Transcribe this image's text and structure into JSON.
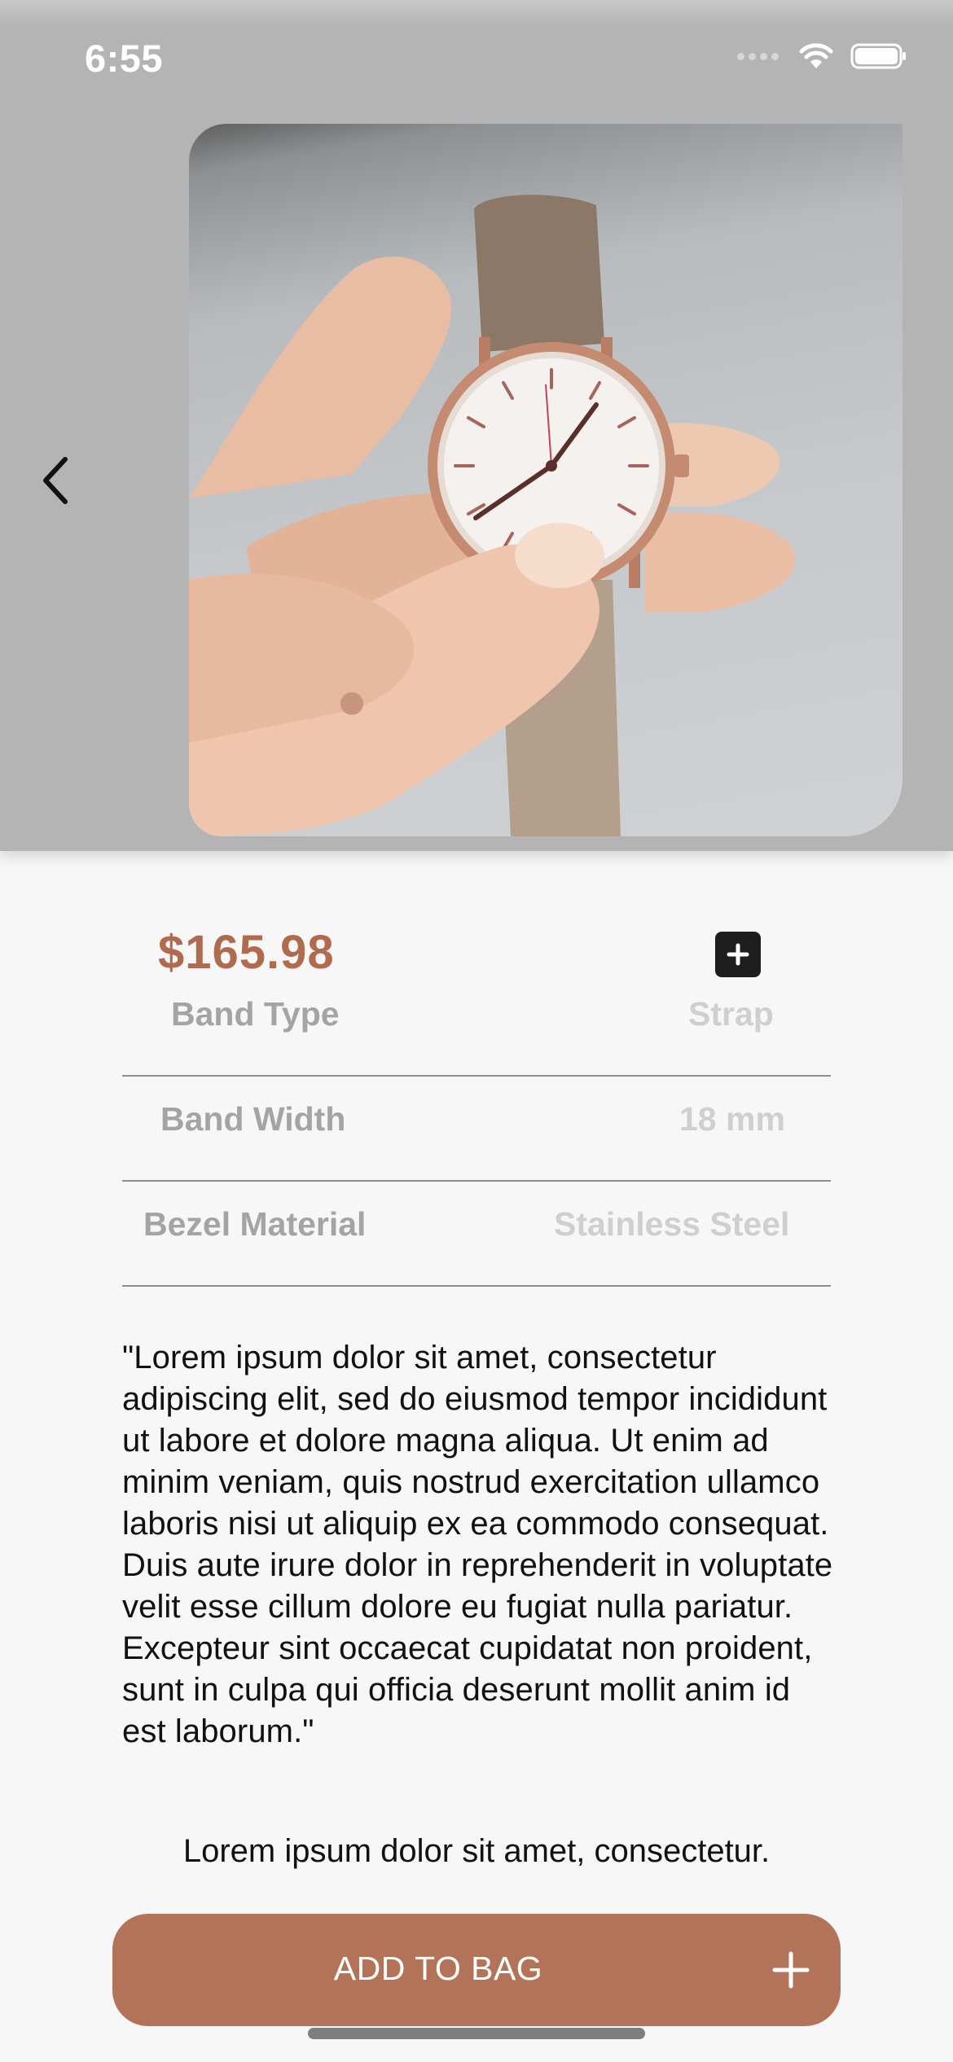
{
  "status_bar": {
    "time": "6:55",
    "icons": [
      "signal-icon",
      "wifi-icon",
      "battery-icon"
    ]
  },
  "header": {
    "back_icon": "chevron-left-icon",
    "image_alt": "Wristwatch with brown strap held in hand"
  },
  "product": {
    "price": "$165.98",
    "add_icon": "plus-square-icon",
    "specs": [
      {
        "label": "Band Type",
        "value": "Strap"
      },
      {
        "label": "Band Width",
        "value": "18 mm"
      },
      {
        "label": "Bezel Material",
        "value": "Stainless Steel"
      }
    ],
    "description": "\"Lorem ipsum dolor sit amet, consectetur adipiscing elit, sed do eiusmod tempor incididunt ut labore et dolore magna aliqua. Ut enim ad minim veniam, quis nostrud exercitation ullamco laboris nisi ut aliquip ex ea commodo consequat. Duis aute irure dolor in reprehenderit in voluptate velit esse cillum dolore eu fugiat nulla pariatur. Excepteur sint occaecat cupidatat non proident, sunt in culpa qui officia deserunt mollit anim id est laborum.\"",
    "tagline": "Lorem ipsum dolor sit amet, consectetur."
  },
  "cta": {
    "label": "ADD TO BAG",
    "icon": "plus-icon"
  },
  "colors": {
    "accent": "#b37358",
    "price": "#b06a4e",
    "header_bg": "#b4b4b4",
    "page_bg": "#f7f7f7"
  }
}
